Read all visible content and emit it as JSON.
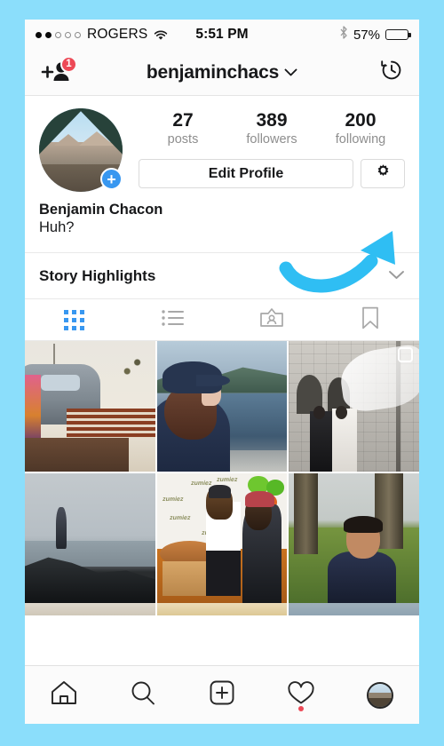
{
  "theme": {
    "page_border_color": "#8BDEFB",
    "accent_blue": "#3897F0",
    "notification_red": "#ED4956",
    "arrow_color": "#2FBEF3",
    "text_primary": "#17181A",
    "text_secondary": "#8E8E8E"
  },
  "status_bar": {
    "signal_dots_filled": 2,
    "signal_dots_total": 5,
    "carrier": "ROGERS",
    "wifi_icon": "wifi-icon",
    "time": "5:51 PM",
    "bluetooth_icon": "bluetooth-icon",
    "battery_percent": "57%",
    "battery_level": 57
  },
  "nav_bar": {
    "add_person_icon": "add-person-icon",
    "add_person_badge": "1",
    "username": "benjaminchacs",
    "chevron_icon": "chevron-down-icon",
    "archive_icon": "archive-clock-icon"
  },
  "profile": {
    "avatar_alt": "mountain-view-from-tent",
    "add_story_badge": "+",
    "stats": [
      {
        "number": "27",
        "label": "posts"
      },
      {
        "number": "389",
        "label": "followers"
      },
      {
        "number": "200",
        "label": "following"
      }
    ],
    "edit_profile_label": "Edit Profile",
    "settings_icon": "gear-icon",
    "full_name": "Benjamin Chacon",
    "bio": "Huh?"
  },
  "annotation": {
    "arrow_icon": "curved-arrow-icon",
    "points_to": "settings-gear-button"
  },
  "highlights": {
    "title": "Story Highlights",
    "chevron_icon": "chevron-down-icon"
  },
  "content_tabs": [
    {
      "name": "grid-tab",
      "icon": "grid-icon",
      "active": true
    },
    {
      "name": "list-tab",
      "icon": "list-icon",
      "active": false
    },
    {
      "name": "tagged-tab",
      "icon": "tagged-person-icon",
      "active": false
    },
    {
      "name": "saved-tab",
      "icon": "bookmark-icon",
      "active": false
    }
  ],
  "photo_grid": [
    {
      "id": "post-1",
      "alt": "silver airstream trailer at sunset with wooden fence",
      "multi_post": false
    },
    {
      "id": "post-2",
      "alt": "person in navy jacket and cap looking at lake with mountains",
      "multi_post": false
    },
    {
      "id": "post-3",
      "alt": "wedding couple outside stone church with flowing veil",
      "multi_post": true
    },
    {
      "id": "post-4",
      "alt": "person standing on dark rocks by misty ocean",
      "multi_post": false
    },
    {
      "id": "post-5",
      "alt": "handshake at zumiez event with green and orange balloons",
      "multi_post": false
    },
    {
      "id": "post-6",
      "alt": "smiling young man in navy shirt on grass between trees",
      "multi_post": false
    }
  ],
  "tab_bar": [
    {
      "name": "home-tab",
      "icon": "home-icon",
      "badge": false
    },
    {
      "name": "search-tab",
      "icon": "search-icon",
      "badge": false
    },
    {
      "name": "new-post-tab",
      "icon": "plus-square-icon",
      "badge": false
    },
    {
      "name": "activity-tab",
      "icon": "heart-icon",
      "badge": true
    },
    {
      "name": "profile-tab",
      "icon": "profile-avatar-icon",
      "badge": false
    }
  ]
}
